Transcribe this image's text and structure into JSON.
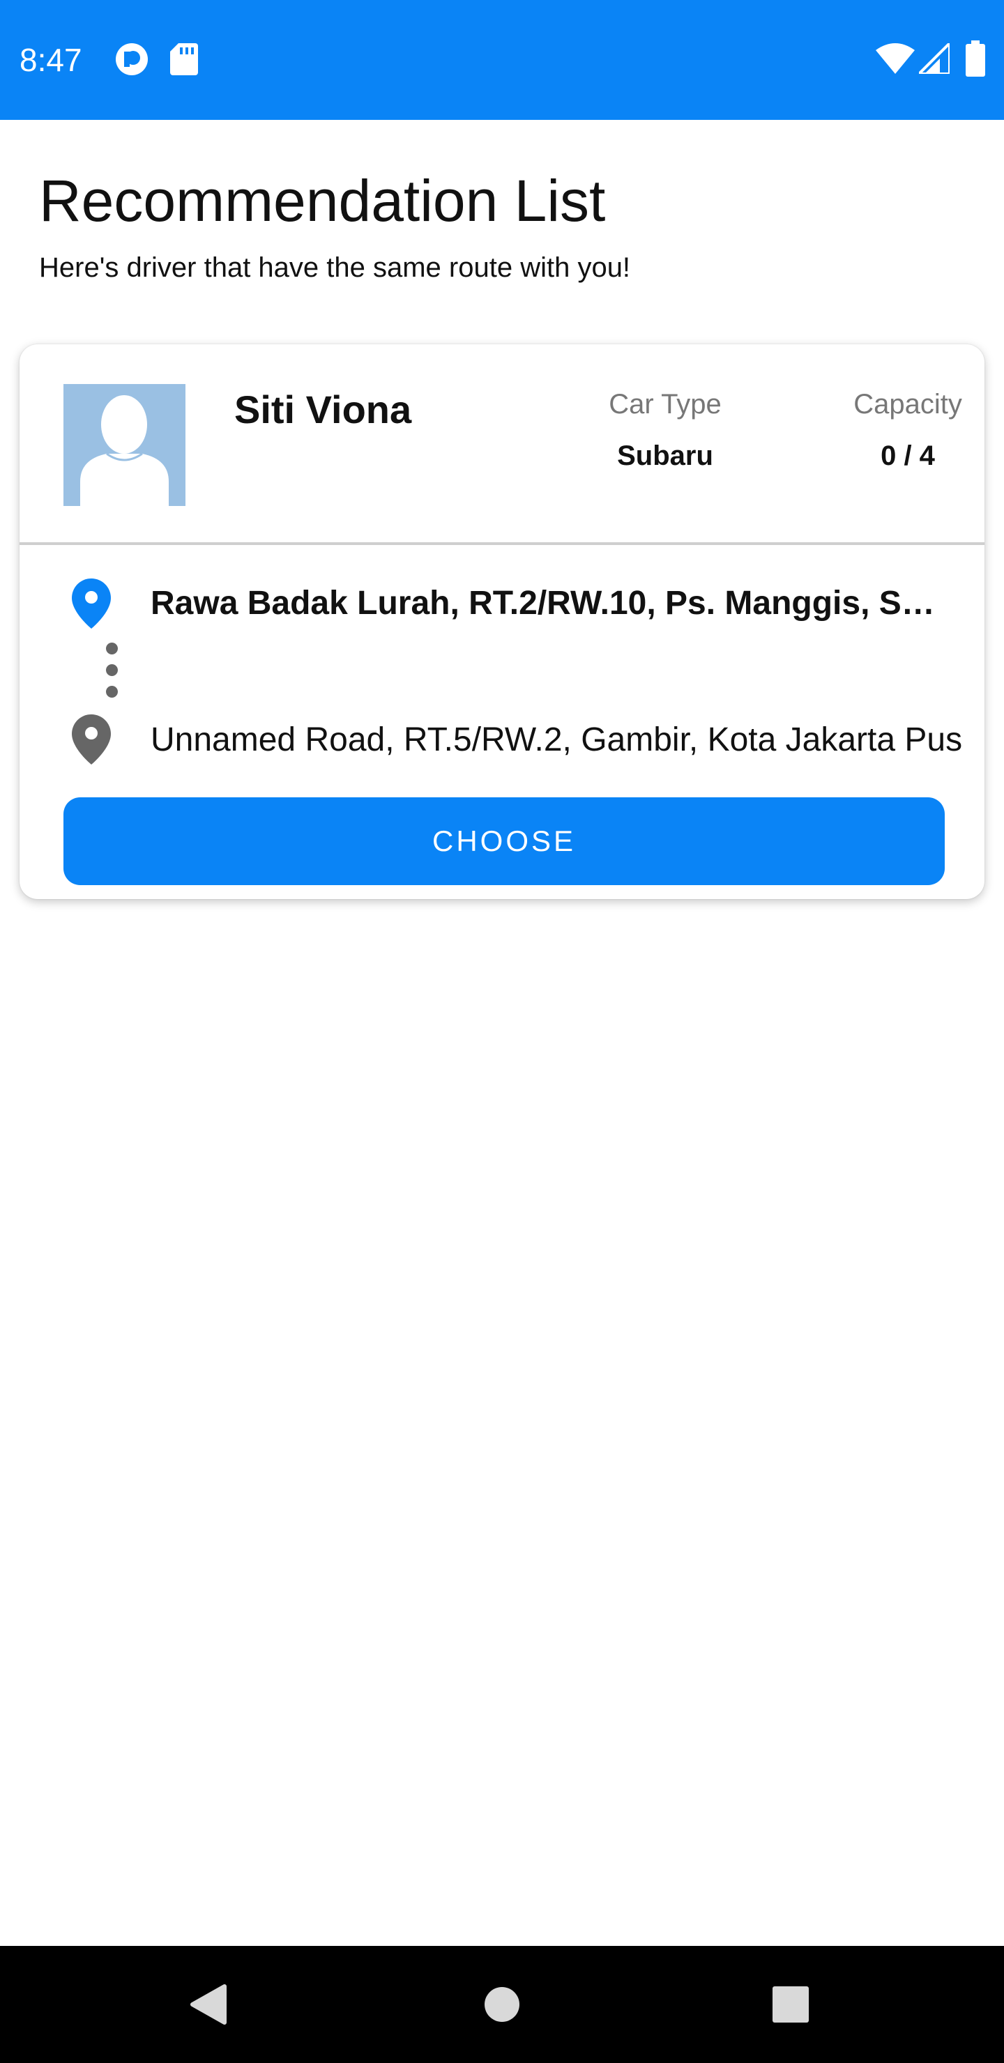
{
  "status_bar": {
    "time": "8:47",
    "background_color": "#0a84f6",
    "left_icons": [
      "pocket-casts-icon",
      "sd-card-icon"
    ],
    "right_icons": [
      "wifi-icon",
      "cell-signal-icon",
      "battery-icon"
    ]
  },
  "header": {
    "title": "Recommendation List",
    "subtitle": "Here's driver that have the same route with you!"
  },
  "drivers": [
    {
      "name": "Siti Viona",
      "avatar_icon": "person-placeholder-icon",
      "car_type_label": "Car Type",
      "car_type": "Subaru",
      "capacity_label": "Capacity",
      "capacity": "0 / 4",
      "origin": "Rawa Badak Lurah,  RT.2/RW.10,  Ps. Manggis,  S…",
      "origin_icon": "location-pin-blue-icon",
      "destination": "Unnamed Road,  RT.5/RW.2,  Gambir,  Kota Jakarta Pus",
      "destination_icon": "location-pin-gray-icon",
      "choose_label": "CHOOSE"
    }
  ],
  "nav_bar": {
    "buttons": [
      "back-icon",
      "home-icon",
      "recents-icon"
    ]
  },
  "colors": {
    "accent": "#0a84f6",
    "text": "#111111",
    "muted": "#777777"
  }
}
